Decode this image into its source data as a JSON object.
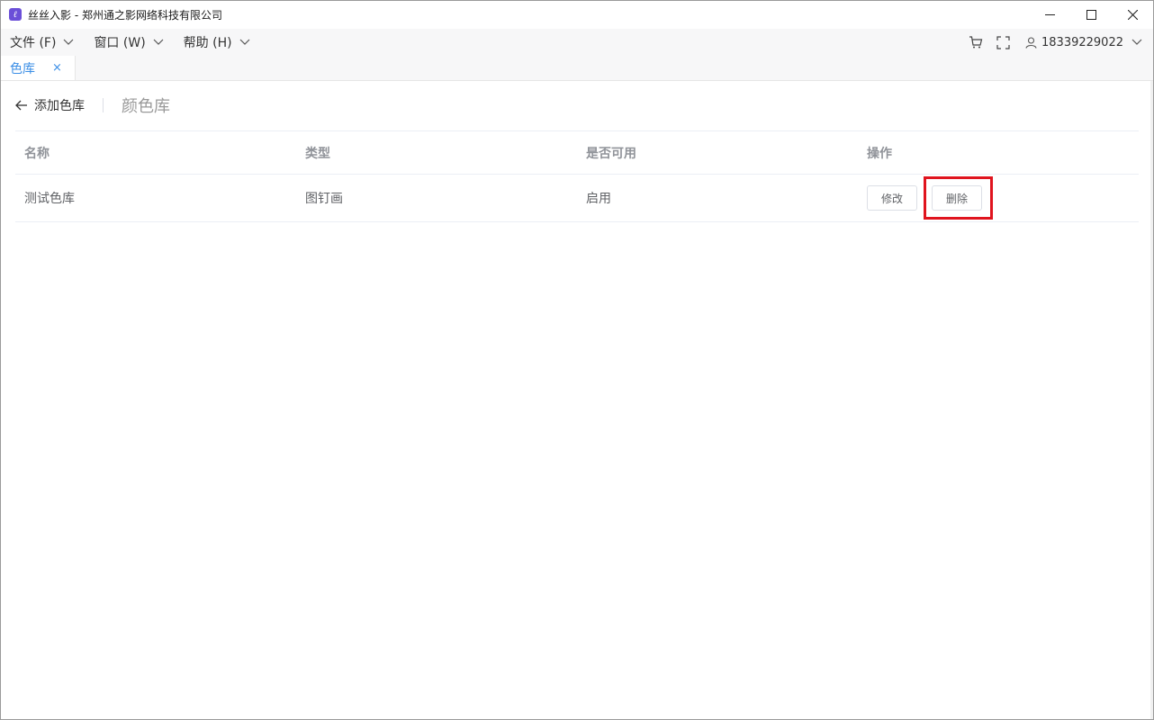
{
  "window": {
    "title": "丝丝入影 - 郑州通之影网络科技有限公司",
    "app_icon": "app-logo-icon"
  },
  "menu": {
    "items": [
      {
        "label": "文件 (F)"
      },
      {
        "label": "窗口 (W)"
      },
      {
        "label": "帮助 (H)"
      }
    ],
    "user": "18339229022"
  },
  "tabs": [
    {
      "label": "色库",
      "close": "×"
    }
  ],
  "header": {
    "back_label": "添加色库",
    "title": "颜色库"
  },
  "table": {
    "columns": [
      "名称",
      "类型",
      "是否可用",
      "操作"
    ],
    "rows": [
      {
        "name": "测试色库",
        "type": "图钉画",
        "enabled": "启用",
        "edit": "修改",
        "delete": "删除"
      }
    ]
  },
  "colors": {
    "accent": "#3a8ee6",
    "highlight": "#e0141e"
  }
}
